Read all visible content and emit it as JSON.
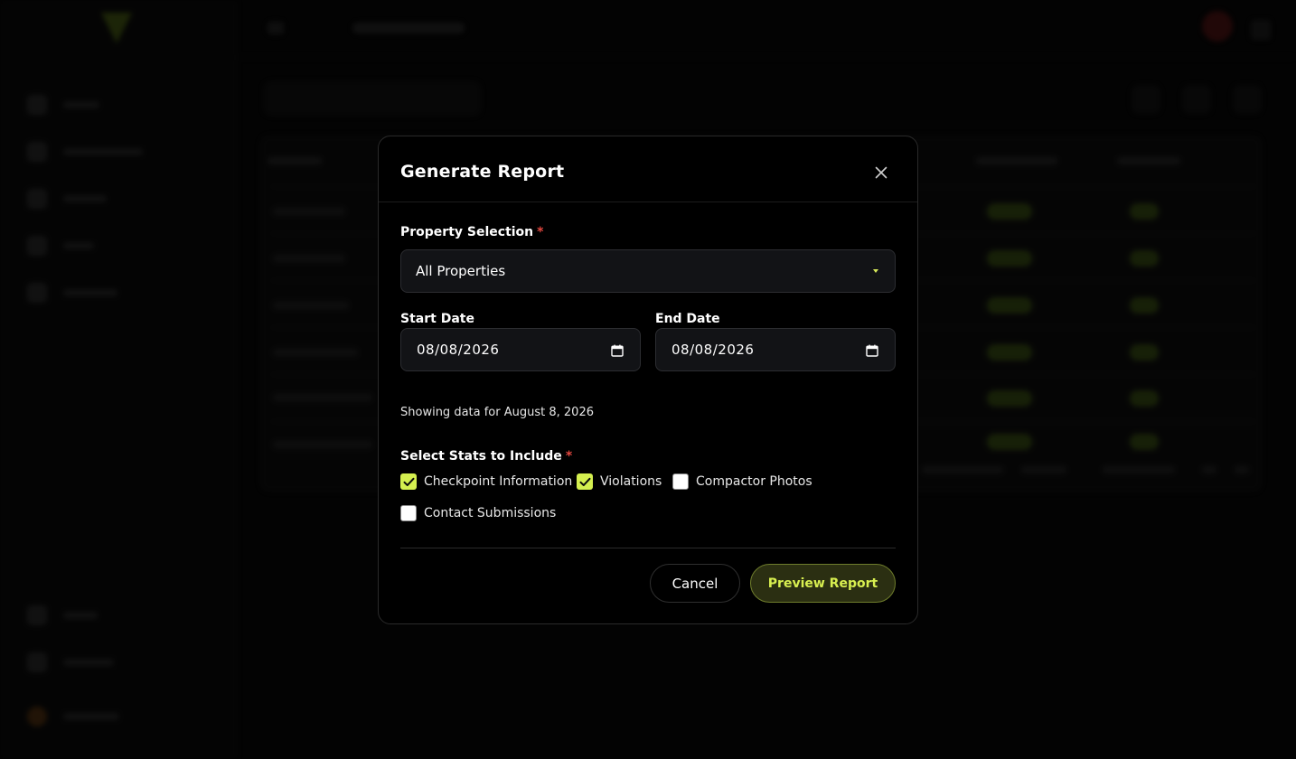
{
  "modal": {
    "title": "Generate Report",
    "close_icon": "close-icon",
    "property_selection": {
      "label": "Property Selection",
      "required_mark": "*",
      "value": "All Properties"
    },
    "start_date": {
      "label": "Start Date",
      "value": "08/08/2026"
    },
    "end_date": {
      "label": "End Date",
      "value": "08/08/2026"
    },
    "summary": "Showing data for August 8, 2026",
    "stats": {
      "label": "Select Stats to Include",
      "required_mark": "*",
      "options": [
        {
          "label": "Checkpoint Information",
          "checked": true
        },
        {
          "label": "Violations",
          "checked": true
        },
        {
          "label": "Compactor Photos",
          "checked": false
        },
        {
          "label": "Contact Submissions",
          "checked": false
        }
      ]
    },
    "buttons": {
      "cancel": "Cancel",
      "preview": "Preview Report"
    }
  },
  "colors": {
    "accent": "#d4ef4f",
    "required": "#e2473f",
    "preview_bg": "#2b2f12"
  }
}
